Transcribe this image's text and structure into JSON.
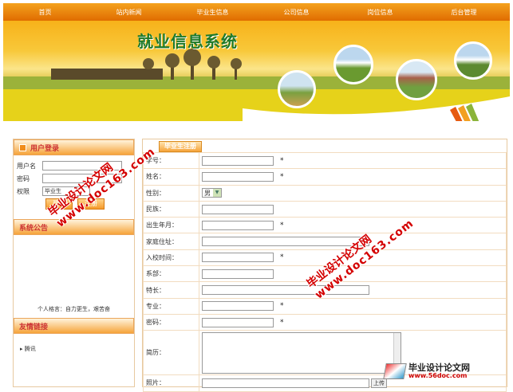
{
  "nav": [
    "首页",
    "站内新闻",
    "毕业生信息",
    "公司信息",
    "岗位信息",
    "后台管理"
  ],
  "banner": {
    "title": "就业信息系统"
  },
  "login": {
    "header": "用户登录",
    "username_label": "用户名",
    "password_label": "密码",
    "role_label": "权限",
    "role_value": "毕业生",
    "login_button": "登录",
    "register_button": "注册"
  },
  "notice": {
    "header": "系统公告",
    "text": "个人格言：自力更生，艰苦奋"
  },
  "links": {
    "header": "友情链接",
    "first": "腾讯"
  },
  "form": {
    "tab": "毕业生注册",
    "rows": [
      {
        "label": "学号："
      },
      {
        "label": "姓名："
      },
      {
        "label": "性别：",
        "value": "男"
      },
      {
        "label": "民族："
      },
      {
        "label": "出生年月："
      },
      {
        "label": "家庭住址："
      },
      {
        "label": "入校时间："
      },
      {
        "label": "系部："
      },
      {
        "label": "特长："
      },
      {
        "label": "专业："
      },
      {
        "label": "密码："
      },
      {
        "label": "简历："
      },
      {
        "label": "照片：",
        "button": "上传"
      }
    ],
    "required_mark": "*"
  },
  "watermarks": {
    "cn": "毕业设计论文网",
    "url": "www.doc163.com"
  },
  "logo": {
    "name": "毕业设计论文网",
    "url": "www.56doc.com"
  }
}
